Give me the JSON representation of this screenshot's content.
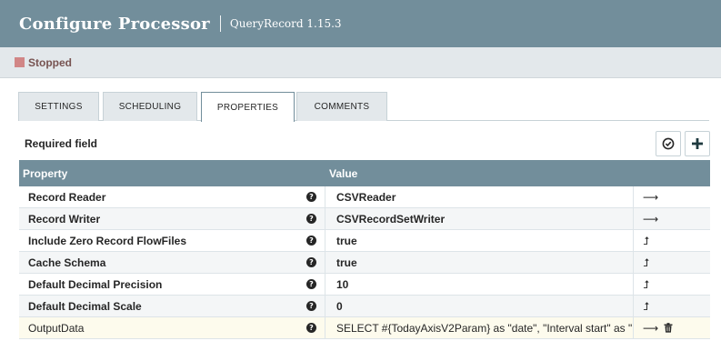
{
  "header": {
    "title": "Configure Processor",
    "subtitle": "QueryRecord 1.15.3"
  },
  "status": {
    "text": "Stopped",
    "color": "#d18686"
  },
  "tabs": [
    {
      "label": "SETTINGS",
      "active": false
    },
    {
      "label": "SCHEDULING",
      "active": false
    },
    {
      "label": "PROPERTIES",
      "active": true
    },
    {
      "label": "COMMENTS",
      "active": false
    }
  ],
  "toolbar": {
    "required_label": "Required field",
    "verify_icon": "check-circle-icon",
    "add_icon": "plus-icon"
  },
  "table": {
    "columns": [
      "Property",
      "Value"
    ],
    "rows": [
      {
        "property": "Record Reader",
        "value": "CSVReader",
        "action": "go-to-arrow"
      },
      {
        "property": "Record Writer",
        "value": "CSVRecordSetWriter",
        "action": "go-to-arrow"
      },
      {
        "property": "Include Zero Record FlowFiles",
        "value": "true",
        "action": "convert-parameter"
      },
      {
        "property": "Cache Schema",
        "value": "true",
        "action": "convert-parameter"
      },
      {
        "property": "Default Decimal Precision",
        "value": "10",
        "action": "convert-parameter"
      },
      {
        "property": "Default Decimal Scale",
        "value": "0",
        "action": "convert-parameter"
      },
      {
        "property": "OutputData",
        "value": "SELECT #{TodayAxisV2Param} as \"date\", \"Interval start\" as \"...",
        "action": "go-to-arrow-delete"
      }
    ]
  },
  "colors": {
    "header": "#728e9b",
    "status_bar": "#e3e8eb",
    "highlight_row": "#fdfbed"
  }
}
